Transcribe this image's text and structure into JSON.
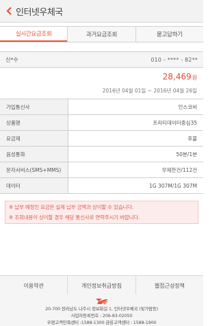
{
  "header": {
    "title": "인터넷우체국"
  },
  "tabs": [
    {
      "label": "실시간요금조회"
    },
    {
      "label": "과거요금조회"
    },
    {
      "label": "묻고답하기"
    }
  ],
  "summary": {
    "phone_label": "신*수",
    "phone_number": "010 - **** - 82**",
    "amount": "28,469",
    "amount_unit": "원",
    "period": "2016년 04월 01일 ~ 2016년 04월 26일"
  },
  "details": [
    {
      "label": "가입통신사",
      "value": "인스코비"
    },
    {
      "label": "상품명",
      "value": "프리티데이터중심35"
    },
    {
      "label": "요금제",
      "value": "후불"
    },
    {
      "label": "음성통화",
      "value": "50분/1분"
    },
    {
      "label": "문자서비스(SMS+MMS)",
      "value": "무제한건/112건"
    },
    {
      "label": "데이터",
      "value": "1G 307M/1G 307M"
    }
  ],
  "notice": [
    "※ 납부 예정인 요금은 실제 납부 금액과 상이할 수 있습니다.",
    "※ 조회내용이 상이할 경우 해당 통신사로 연락주시기 바랍니다."
  ],
  "footer_links": [
    {
      "label": "이용약관"
    },
    {
      "label": "개인정보취급방침"
    },
    {
      "label": "웹접근성정책"
    }
  ],
  "footer": {
    "address": "20-700 전라남도 나주시 정보화길 1, 인터넷우체국 (빛가람동)",
    "business_no": "사업자등록번호 : 206-83-02050",
    "contact": "우편고객만족센터 :1588-1300 금융고객센터 : 1588-1900"
  },
  "colors": {
    "accent": "#e8543a"
  }
}
